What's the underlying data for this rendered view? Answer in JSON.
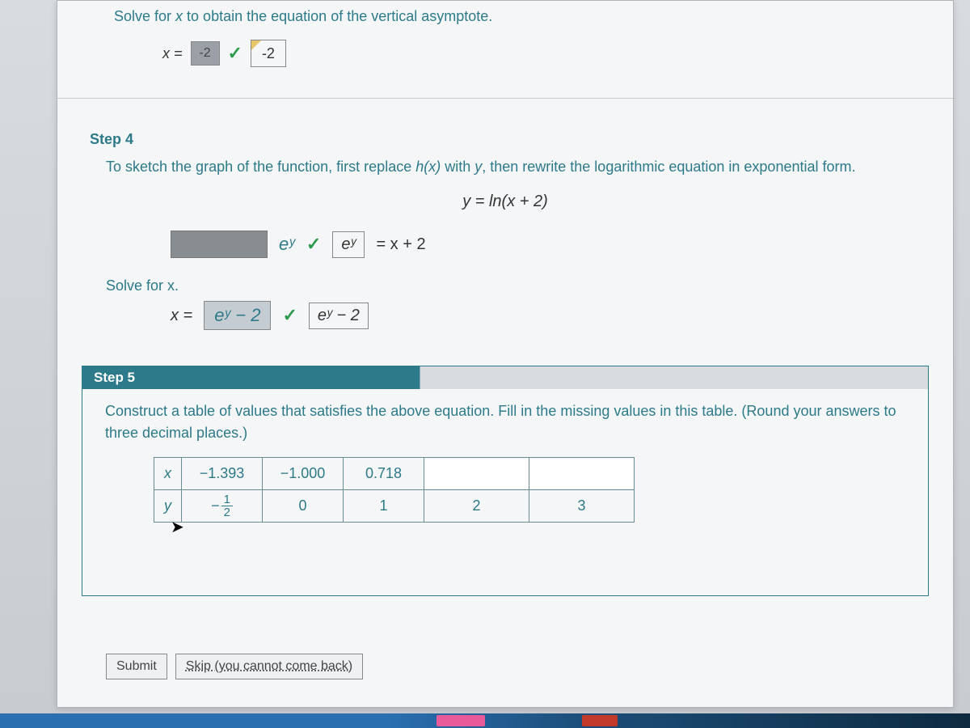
{
  "top": {
    "instruction_pre": "Solve for ",
    "instruction_var": "x",
    "instruction_post": " to obtain the equation of the vertical asymptote.",
    "lhs": "x =",
    "entered": "-2",
    "answer": "-2"
  },
  "step4": {
    "label": "Step 4",
    "body_pre": "To sketch the graph of the function, first replace ",
    "body_hx": "h(x)",
    "body_mid": " with ",
    "body_y": "y",
    "body_post": ", then rewrite the logarithmic equation in exponential form.",
    "eq_center": "y = ln(x + 2)",
    "exp_input_label": "eʸ",
    "exp_boxed": "eʸ",
    "exp_rhs": " = x + 2",
    "solve_label": "Solve for x.",
    "solve_lhs": "x =",
    "solve_entered": "eʸ − 2",
    "solve_answer": "eʸ − 2"
  },
  "step5": {
    "label": "Step 5",
    "body": "Construct a table of values that satisfies the above equation. Fill in the missing values in this table. (Round your answers to three decimal places.)",
    "row_x_label": "x",
    "row_y_label": "y",
    "x_vals": [
      "−1.393",
      "−1.000",
      "0.718",
      "",
      ""
    ],
    "y_vals_text": [
      "",
      "0",
      "1",
      "2",
      "3"
    ],
    "y_first_frac": {
      "neg": "−",
      "num": "1",
      "den": "2"
    }
  },
  "buttons": {
    "submit": "Submit",
    "skip": "Skip (you cannot come back)"
  }
}
